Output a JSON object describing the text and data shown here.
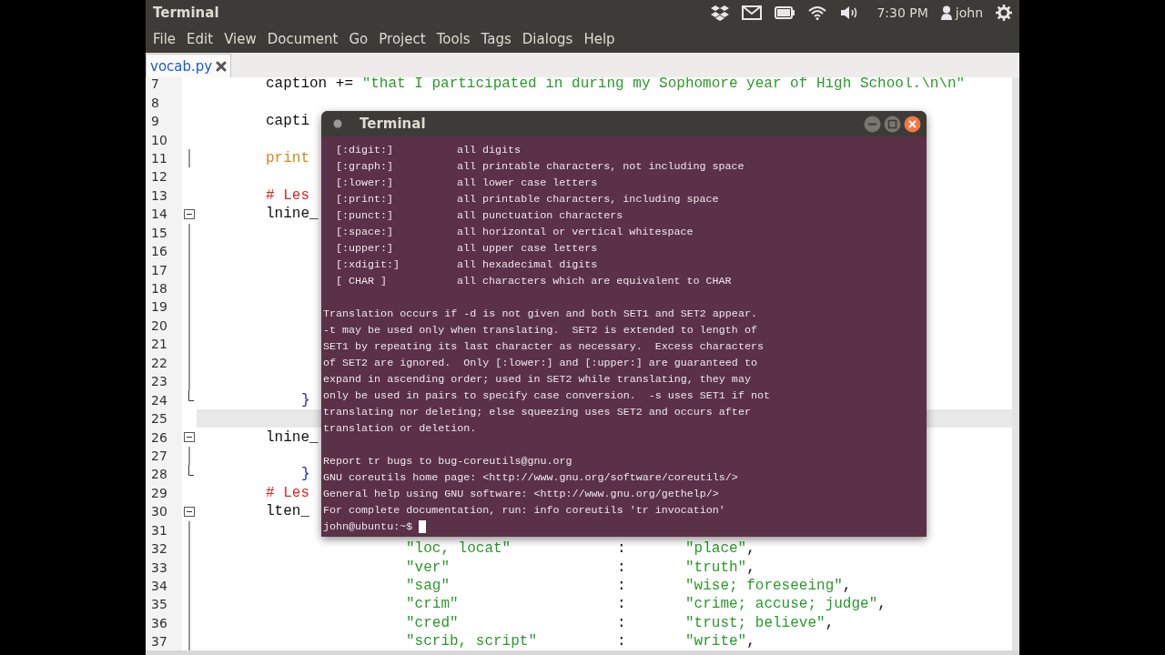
{
  "top_bar": {
    "title": "Terminal",
    "clock": "7:30 PM",
    "user": "john"
  },
  "menu": [
    "File",
    "Edit",
    "View",
    "Document",
    "Go",
    "Project",
    "Tools",
    "Tags",
    "Dialogs",
    "Help"
  ],
  "tabs": [
    {
      "label": "vocab.py",
      "selected": true
    }
  ],
  "editor": {
    "lines": [
      {
        "number": "7",
        "kind": "stmt",
        "tokens": [
          {
            "kind": "plain",
            "text": "caption += "
          },
          {
            "kind": "string",
            "text": "\"that I participated in during my Sophomore year of High School.\\n\\n\""
          }
        ]
      },
      {
        "number": "8"
      },
      {
        "number": "9",
        "kind": "stmt",
        "tokens": [
          {
            "kind": "plain",
            "text": "capti"
          }
        ]
      },
      {
        "number": "10"
      },
      {
        "number": "11",
        "fold": {
          "kind": "line"
        },
        "kind": "stmt",
        "tokens": [
          {
            "kind": "keyword",
            "text": "print"
          }
        ]
      },
      {
        "number": "12"
      },
      {
        "number": "13",
        "kind": "stmt",
        "tokens": [
          {
            "kind": "comment",
            "text": "# Les"
          }
        ]
      },
      {
        "number": "14",
        "fold": {
          "kind": "start"
        },
        "kind": "stmt",
        "tokens": [
          {
            "kind": "plain",
            "text": "lnine_"
          }
        ]
      },
      {
        "number": "15",
        "fold": {
          "kind": "line"
        }
      },
      {
        "number": "16",
        "fold": {
          "kind": "line"
        }
      },
      {
        "number": "17",
        "fold": {
          "kind": "line"
        }
      },
      {
        "number": "18",
        "fold": {
          "kind": "line"
        }
      },
      {
        "number": "19",
        "fold": {
          "kind": "line"
        }
      },
      {
        "number": "20",
        "fold": {
          "kind": "line"
        }
      },
      {
        "number": "21",
        "fold": {
          "kind": "line"
        }
      },
      {
        "number": "22",
        "fold": {
          "kind": "line"
        }
      },
      {
        "number": "23",
        "fold": {
          "kind": "line"
        }
      },
      {
        "number": "24",
        "fold": {
          "kind": "end"
        },
        "kind": "close",
        "tokens": [
          {
            "kind": "brace",
            "text": "}"
          }
        ]
      },
      {
        "number": "25",
        "current": true
      },
      {
        "number": "26",
        "fold": {
          "kind": "start"
        },
        "kind": "stmt",
        "tokens": [
          {
            "kind": "plain",
            "text": "lnine_"
          }
        ]
      },
      {
        "number": "27",
        "fold": {
          "kind": "line"
        }
      },
      {
        "number": "28",
        "fold": {
          "kind": "end"
        },
        "kind": "close",
        "tokens": [
          {
            "kind": "brace",
            "text": "}"
          }
        ]
      },
      {
        "number": "29",
        "kind": "stmt",
        "tokens": [
          {
            "kind": "comment",
            "text": "# Les"
          }
        ]
      },
      {
        "number": "30",
        "fold": {
          "kind": "start"
        },
        "kind": "stmt",
        "tokens": [
          {
            "kind": "plain",
            "text": "lten_"
          }
        ]
      },
      {
        "number": "31",
        "fold": {
          "kind": "line"
        }
      },
      {
        "number": "32",
        "fold": {
          "kind": "line"
        },
        "kind": "entry",
        "key": "\"loc, locat\"",
        "sep": ":",
        "value": "\"place\"",
        "trail": ","
      },
      {
        "number": "33",
        "fold": {
          "kind": "line"
        },
        "kind": "entry",
        "key": "\"ver\"",
        "sep": ":",
        "value": "\"truth\"",
        "trail": ","
      },
      {
        "number": "34",
        "fold": {
          "kind": "line"
        },
        "kind": "entry",
        "key": "\"sag\"",
        "sep": ":",
        "value": "\"wise; foreseeing\"",
        "trail": ","
      },
      {
        "number": "35",
        "fold": {
          "kind": "line"
        },
        "kind": "entry",
        "key": "\"crim\"",
        "sep": ":",
        "value": "\"crime; accuse; judge\"",
        "trail": ","
      },
      {
        "number": "36",
        "fold": {
          "kind": "line"
        },
        "kind": "entry",
        "key": "\"cred\"",
        "sep": ":",
        "value": "\"trust; believe\"",
        "trail": ","
      },
      {
        "number": "37",
        "fold": {
          "kind": "line"
        },
        "kind": "entry",
        "key": "\"scrib, script\"",
        "sep": ":",
        "value": "\"write\"",
        "trail": ","
      }
    ]
  },
  "terminal": {
    "title": "Terminal",
    "class_rows": [
      {
        "name": "[:digit:]",
        "description": "all digits"
      },
      {
        "name": "[:graph:]",
        "description": "all printable characters, not including space"
      },
      {
        "name": "[:lower:]",
        "description": "all lower case letters"
      },
      {
        "name": "[:print:]",
        "description": "all printable characters, including space"
      },
      {
        "name": "[:punct:]",
        "description": "all punctuation characters"
      },
      {
        "name": "[:space:]",
        "description": "all horizontal or vertical whitespace"
      },
      {
        "name": "[:upper:]",
        "description": "all upper case letters"
      },
      {
        "name": "[:xdigit:]",
        "description": "all hexadecimal digits"
      },
      {
        "name": "[ CHAR ]",
        "description": "all characters which are equivalent to CHAR"
      }
    ],
    "paragraphs": [
      [
        "Translation occurs if -d is not given and both SET1 and SET2 appear.",
        "-t may be used only when translating.  SET2 is extended to length of",
        "SET1 by repeating its last character as necessary.  Excess characters",
        "of SET2 are ignored.  Only [:lower:] and [:upper:] are guaranteed to",
        "expand in ascending order; used in SET2 while translating, they may",
        "only be used in pairs to specify case conversion.  -s uses SET1 if not",
        "translating nor deleting; else squeezing uses SET2 and occurs after",
        "translation or deletion."
      ],
      [
        "Report tr bugs to bug-coreutils@gnu.org",
        "GNU coreutils home page: <http://www.gnu.org/software/coreutils/>",
        "General help using GNU software: <http://www.gnu.org/gethelp/>",
        "For complete documentation, run: info coreutils 'tr invocation'"
      ]
    ],
    "prompt": "john@ubuntu:~$",
    "cursor": true
  }
}
